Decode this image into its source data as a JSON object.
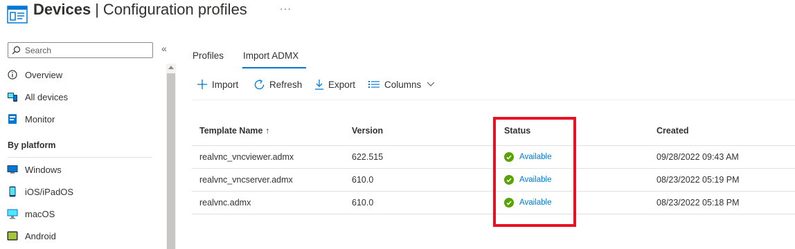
{
  "header": {
    "title_strong": "Devices",
    "title_separator": "|",
    "title_rest": "Configuration profiles",
    "more_label": "···",
    "icon": "configuration-profiles-icon"
  },
  "sidebar": {
    "search_placeholder": "Search",
    "collapse_label": "«",
    "items": [
      {
        "label": "Overview",
        "icon": "info-icon"
      },
      {
        "label": "All devices",
        "icon": "devices-icon"
      },
      {
        "label": "Monitor",
        "icon": "monitor-icon"
      }
    ],
    "section_title": "By platform",
    "platforms": [
      {
        "label": "Windows",
        "icon": "windows-icon"
      },
      {
        "label": "iOS/iPadOS",
        "icon": "phone-icon"
      },
      {
        "label": "macOS",
        "icon": "desktop-icon"
      },
      {
        "label": "Android",
        "icon": "android-icon"
      }
    ]
  },
  "tabs": [
    {
      "label": "Profiles",
      "active": false
    },
    {
      "label": "Import ADMX",
      "active": true
    }
  ],
  "toolbar": {
    "import_label": "Import",
    "refresh_label": "Refresh",
    "export_label": "Export",
    "columns_label": "Columns"
  },
  "table": {
    "columns": [
      "Template Name ↑",
      "Version",
      "Status",
      "Created"
    ],
    "rows": [
      {
        "name": "realvnc_vncviewer.admx",
        "version": "622.515",
        "status": "Available",
        "created": "09/28/2022 09:43 AM"
      },
      {
        "name": "realvnc_vncserver.admx",
        "version": "610.0",
        "status": "Available",
        "created": "08/23/2022 05:19 PM"
      },
      {
        "name": "realvnc.admx",
        "version": "610.0",
        "status": "Available",
        "created": "08/23/2022 05:18 PM"
      }
    ]
  },
  "colors": {
    "accent": "#0078d4",
    "status_ok": "#57a300",
    "highlight": "#e81123"
  }
}
